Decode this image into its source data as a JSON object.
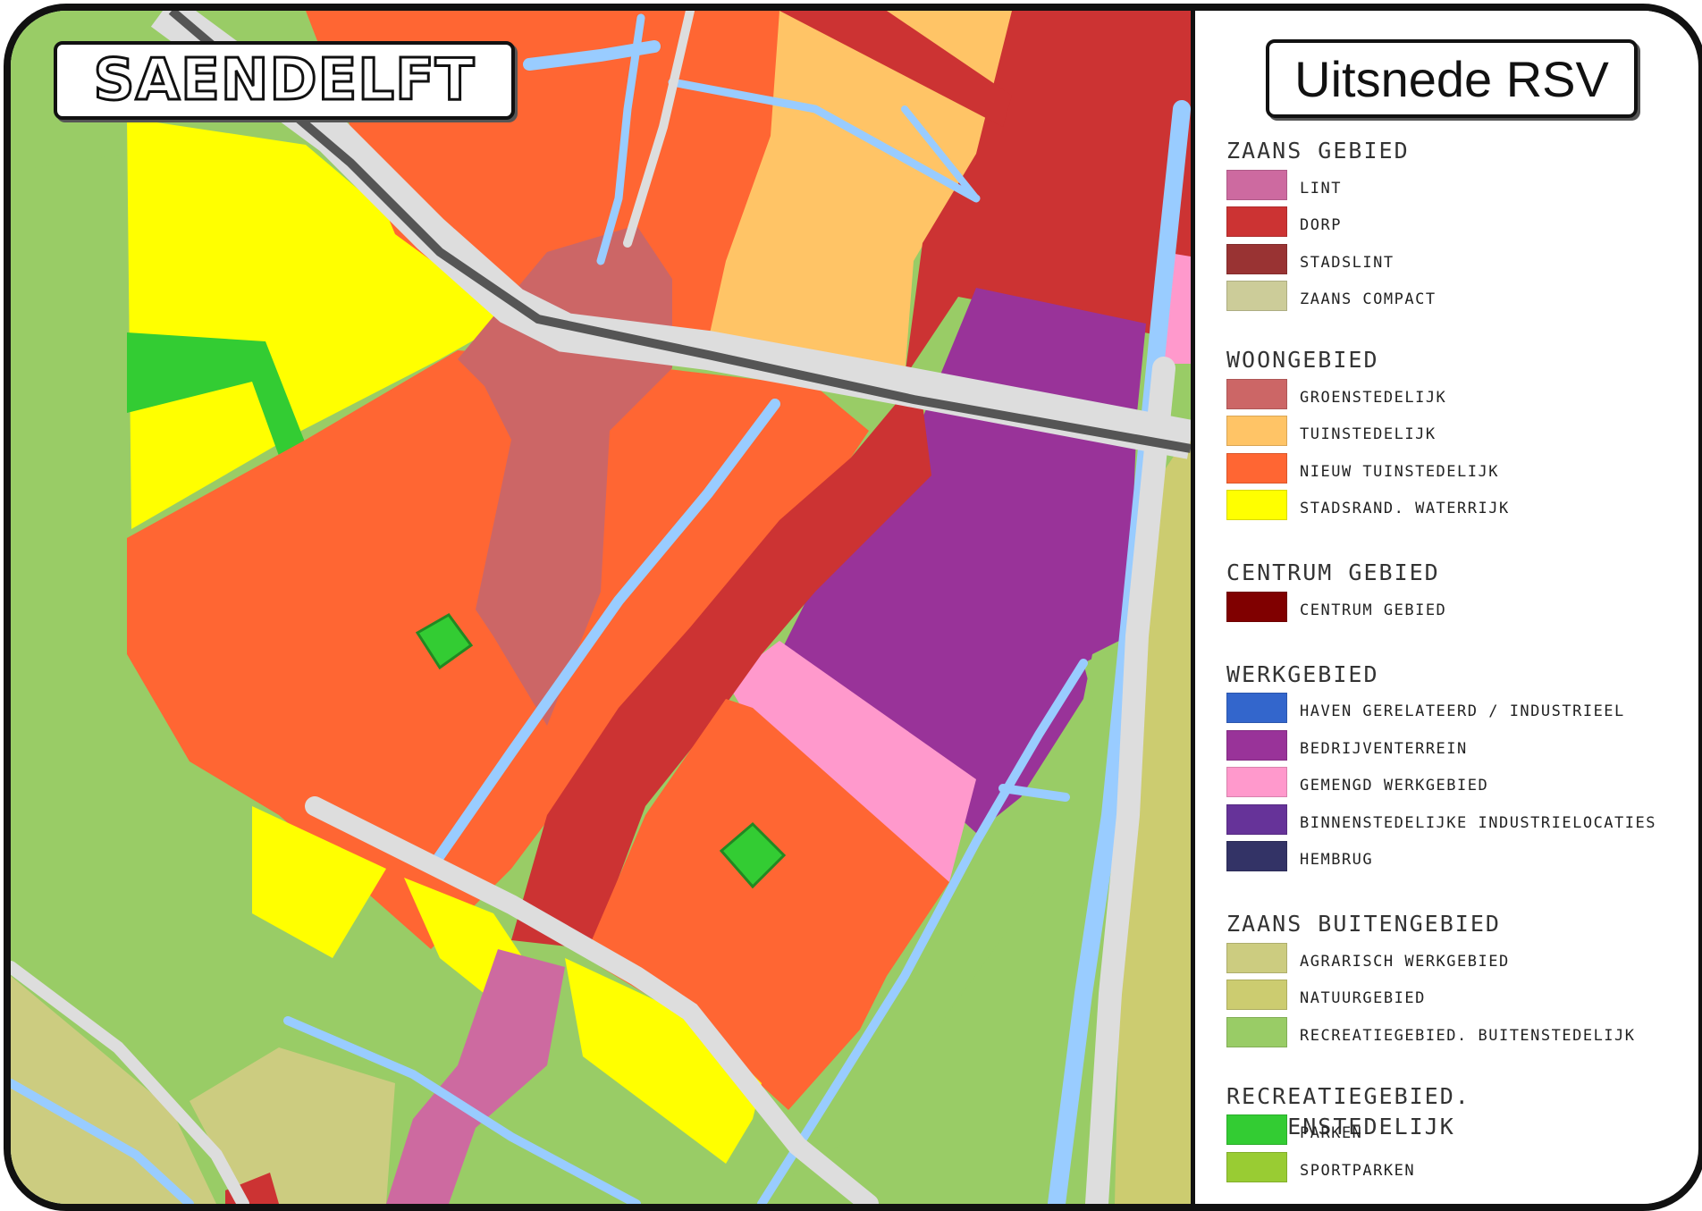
{
  "map_title": "SAENDELFT",
  "legend_title": "Uitsnede RSV",
  "legend": [
    {
      "heading": "ZAANS GEBIED",
      "items": [
        {
          "label": "LINT",
          "color": "#cd6aa0"
        },
        {
          "label": "DORP",
          "color": "#cc3333"
        },
        {
          "label": "STADSLINT",
          "color": "#993333"
        },
        {
          "label": "ZAANS COMPACT",
          "color": "#cccc99"
        }
      ]
    },
    {
      "heading": "WOONGEBIED",
      "items": [
        {
          "label": "GROENSTEDELIJK",
          "color": "#cc6666"
        },
        {
          "label": "TUINSTEDELIJK",
          "color": "#ffc466"
        },
        {
          "label": "NIEUW TUINSTEDELIJK",
          "color": "#ff6633"
        },
        {
          "label": "STADSRAND. WATERRIJK",
          "color": "#ffff00"
        }
      ]
    },
    {
      "heading": "CENTRUM GEBIED",
      "items": [
        {
          "label": "CENTRUM GEBIED",
          "color": "#800000"
        }
      ]
    },
    {
      "heading": "WERKGEBIED",
      "items": [
        {
          "label": "HAVEN GERELATEERD / INDUSTRIEEL",
          "color": "#3366cc"
        },
        {
          "label": "BEDRIJVENTERREIN",
          "color": "#993399"
        },
        {
          "label": "GEMENGD WERKGEBIED",
          "color": "#ff99cc"
        },
        {
          "label": "BINNENSTEDELIJKE INDUSTRIELOCATIES",
          "color": "#663399"
        },
        {
          "label": "HEMBRUG",
          "color": "#333366"
        }
      ]
    },
    {
      "heading": "ZAANS BUITENGEBIED",
      "items": [
        {
          "label": "AGRARISCH WERKGEBIED",
          "color": "#cccc80"
        },
        {
          "label": "NATUURGEBIED",
          "color": "#cccc70"
        },
        {
          "label": "RECREATIEGEBIED. BUITENSTEDELIJK",
          "color": "#99cc66"
        }
      ]
    },
    {
      "heading": "RECREATIEGEBIED. BINNENSTEDELIJK",
      "items": [
        {
          "label": "PARKEN",
          "color": "#33cc33"
        },
        {
          "label": "SPORTPARKEN",
          "color": "#99cc33"
        }
      ]
    }
  ]
}
